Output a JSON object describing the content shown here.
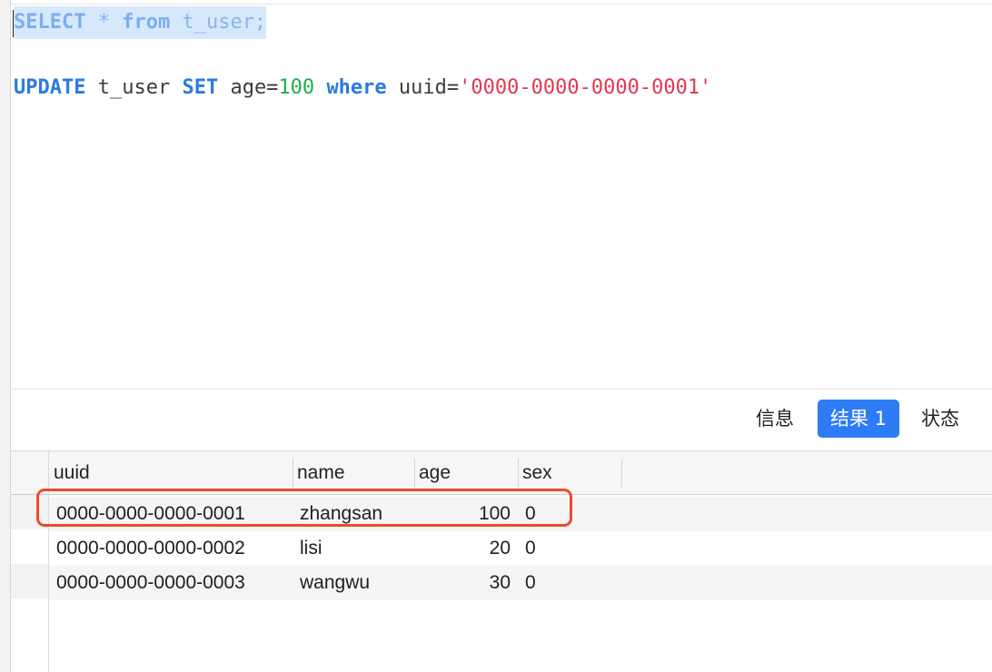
{
  "editor": {
    "line1": {
      "kw_select": "SELECT",
      "rest1": " * ",
      "kw_from": "from",
      "rest2": " t_user;"
    },
    "line2": {
      "kw_update": "UPDATE",
      "t1": " t_user ",
      "kw_set": "SET",
      "t2": " age=",
      "num": "100",
      "t3": " ",
      "kw_where": "where",
      "t4": " uuid=",
      "str": "'0000-0000-0000-0001'"
    }
  },
  "tabs": {
    "info": "信息",
    "result": "结果 1",
    "status": "状态",
    "active": "result"
  },
  "grid": {
    "columns": [
      "uuid",
      "name",
      "age",
      "sex"
    ],
    "rows": [
      {
        "uuid": "0000-0000-0000-0001",
        "name": "zhangsan",
        "age": "100",
        "sex": "0"
      },
      {
        "uuid": "0000-0000-0000-0002",
        "name": "lisi",
        "age": "20",
        "sex": "0"
      },
      {
        "uuid": "0000-0000-0000-0003",
        "name": "wangwu",
        "age": "30",
        "sex": "0"
      }
    ],
    "highlighted_row": 0
  },
  "colors": {
    "accent": "#2d7cf6",
    "keyword": "#2a7ae4",
    "number": "#1bb04b",
    "string": "#e2374f",
    "highlight": "#ee4a2c"
  }
}
